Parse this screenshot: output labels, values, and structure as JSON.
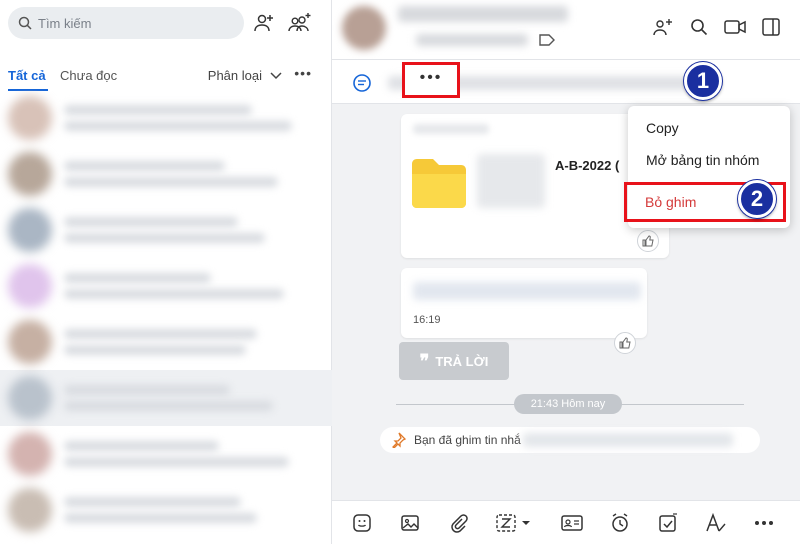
{
  "sidebar": {
    "search_placeholder": "Tìm kiếm",
    "tabs": {
      "all": "Tất cả",
      "unread": "Chưa đọc"
    },
    "classify_label": "Phân loại",
    "more": "•••"
  },
  "chat": {
    "pin_more": "•••",
    "menu": {
      "copy": "Copy",
      "open_board": "Mở bảng tin nhóm",
      "unpin": "Bỏ ghim"
    },
    "file_name": "A-B-2022 ( ",
    "time": "16:19",
    "reply_button": "TRẢ LỜI",
    "date_separator": "21:43 Hôm nay",
    "pinned_notice": "Bạn đã ghim tin nhắ"
  },
  "annotations": {
    "step1": "1",
    "step2": "2"
  },
  "colors": {
    "accent": "#1565d8",
    "highlight": "#e8121a",
    "danger": "#d43a3a",
    "badge": "#1a2fa0",
    "folder": "#f6c938"
  }
}
